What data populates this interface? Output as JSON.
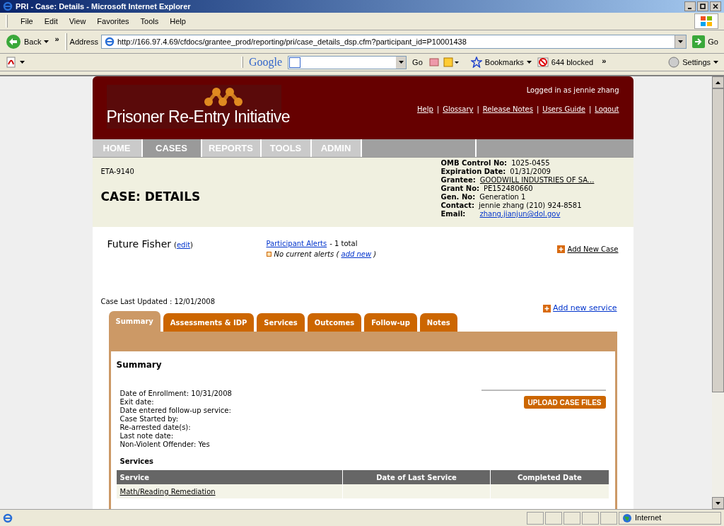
{
  "window": {
    "title": "PRI - Case: Details - Microsoft Internet Explorer"
  },
  "menu_bar": [
    "File",
    "Edit",
    "View",
    "Favorites",
    "Tools",
    "Help"
  ],
  "nav_toolbar": {
    "back": "Back",
    "chevron": "»",
    "address_label": "Address",
    "url": "http://166.97.4.69/cfdocs/grantee_prod/reporting/pri/case_details_dsp.cfm?participant_id=P10001438",
    "go": "Go"
  },
  "google_toolbar": {
    "logo": "Google",
    "go": "Go",
    "bookmarks": "Bookmarks",
    "blocked": "644 blocked",
    "chevron": "»",
    "settings": "Settings"
  },
  "header": {
    "logo_text": "Prisoner Re-Entry Initiative",
    "logged_in": "Logged in as jennie zhang",
    "separator": "|",
    "links": [
      "Help",
      "Glossary",
      "Release Notes",
      "Users Guide",
      "Logout"
    ]
  },
  "nav": [
    {
      "label": "HOME",
      "selected": false
    },
    {
      "label": "CASES",
      "selected": true
    },
    {
      "label": "REPORTS",
      "selected": false
    },
    {
      "label": "TOOLS",
      "selected": false
    },
    {
      "label": "ADMIN",
      "selected": false
    }
  ],
  "info": {
    "form_id": "ETA-9140",
    "page_title": "CASE: DETAILS",
    "fields": [
      {
        "label": "OMB Control No:",
        "value": "1025-0455",
        "kind": "text"
      },
      {
        "label": "Expiration Date:",
        "value": "01/31/2009",
        "kind": "text"
      },
      {
        "label": "Grantee:",
        "value": "GOODWILL INDUSTRIES OF SA...",
        "kind": "link"
      },
      {
        "label": "Grant No:",
        "value": "PE152480660",
        "kind": "text"
      },
      {
        "label": "Gen. No:",
        "value": "Generation 1",
        "kind": "text"
      },
      {
        "label": "Contact:",
        "value": "jennie zhang  (210) 924-8581",
        "kind": "text"
      },
      {
        "label": "Email:",
        "value": "zhang.jianjun@dol.gov",
        "kind": "email"
      }
    ]
  },
  "participant": {
    "name": "Future Fisher",
    "edit_open": "(",
    "edit_link": "edit",
    "edit_close": ")",
    "alerts_link": "Participant Alerts",
    "alerts_count": "- 1 total",
    "no_alerts": "No current alerts (",
    "add_new": "add new",
    "no_alerts_close": ")",
    "add_case": "Add New Case",
    "last_updated": "Case Last Updated : 12/01/2008",
    "add_service": "Add new service"
  },
  "case_tabs": [
    {
      "label": "Summary",
      "selected": true
    },
    {
      "label": "Assessments & IDP",
      "selected": false
    },
    {
      "label": "Services",
      "selected": false
    },
    {
      "label": "Outcomes",
      "selected": false
    },
    {
      "label": "Follow-up",
      "selected": false
    },
    {
      "label": "Notes",
      "selected": false
    }
  ],
  "summary": {
    "title": "Summary",
    "details": [
      "Date of Enrollment: 10/31/2008",
      "Exit date:",
      "Date entered follow-up service:",
      "Case Started by:",
      "Re-arrested date(s):",
      "Last note date:",
      "Non-Violent Offender: Yes"
    ],
    "upload_button": "UPLOAD CASE FILES",
    "services_heading": "Services",
    "columns": [
      "Service",
      "Date of Last Service",
      "Completed Date"
    ],
    "rows": [
      {
        "service": "Math/Reading Remediation"
      }
    ]
  },
  "status_bar": {
    "zone": "Internet"
  }
}
